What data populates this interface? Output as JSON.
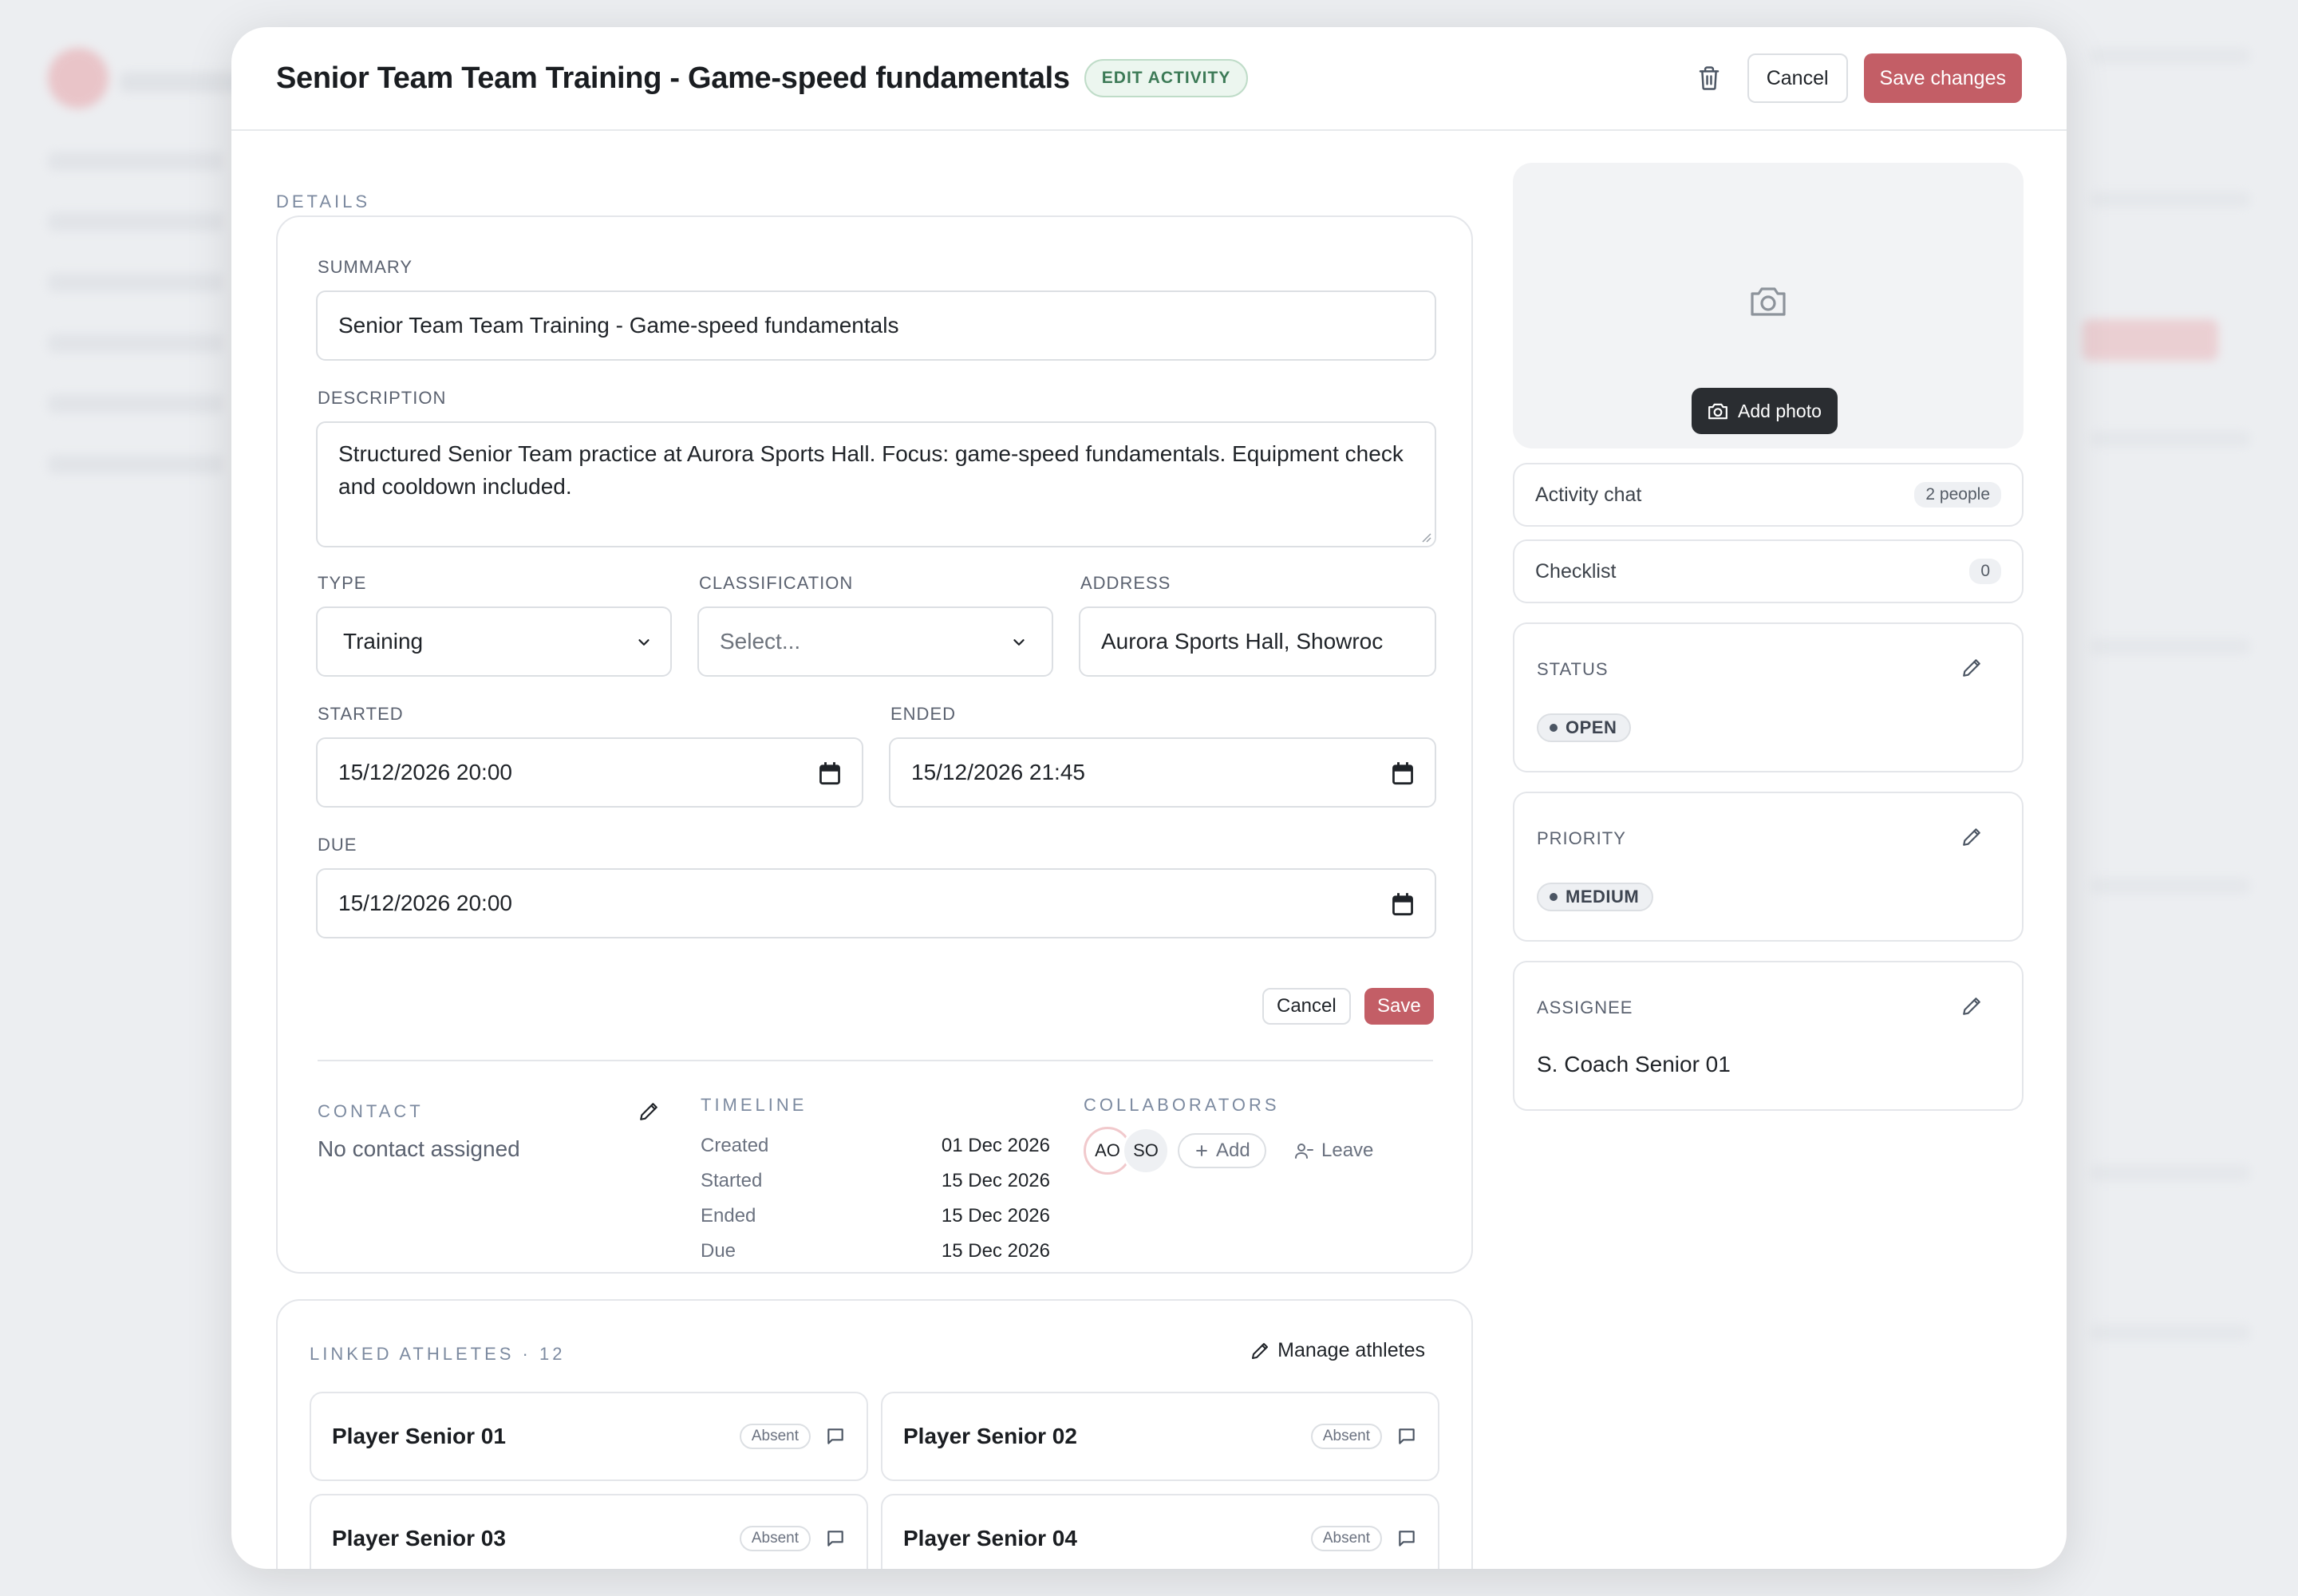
{
  "modal": {
    "title": "Senior Team Team Training - Game-speed fundamentals",
    "badge": "EDIT ACTIVITY",
    "cancel_label": "Cancel",
    "save_label": "Save changes"
  },
  "details": {
    "section_label": "DETAILS",
    "summary": {
      "label": "SUMMARY",
      "value": "Senior Team Team Training - Game-speed fundamentals"
    },
    "description": {
      "label": "DESCRIPTION",
      "value": "Structured Senior Team practice at Aurora Sports Hall. Focus: game-speed fundamentals. Equipment check and cooldown included."
    },
    "type": {
      "label": "TYPE",
      "value": "Training"
    },
    "classification": {
      "label": "CLASSIFICATION",
      "placeholder": "Select..."
    },
    "address": {
      "label": "ADDRESS",
      "value": "Aurora Sports Hall, Showroc"
    },
    "started": {
      "label": "STARTED",
      "value": "15/12/2026 20:00"
    },
    "ended": {
      "label": "ENDED",
      "value": "15/12/2026 21:45"
    },
    "due": {
      "label": "DUE",
      "value": "15/12/2026 20:00"
    },
    "form_cancel": "Cancel",
    "form_save": "Save"
  },
  "contact": {
    "label": "CONTACT",
    "value": "No contact assigned"
  },
  "timeline": {
    "label": "TIMELINE",
    "rows": [
      {
        "label": "Created",
        "value": "01 Dec 2026"
      },
      {
        "label": "Started",
        "value": "15 Dec 2026"
      },
      {
        "label": "Ended",
        "value": "15 Dec 2026"
      },
      {
        "label": "Due",
        "value": "15 Dec 2026"
      }
    ]
  },
  "collaborators": {
    "label": "COLLABORATORS",
    "avatars": [
      "AO",
      "SO"
    ],
    "add_label": "Add",
    "leave_label": "Leave"
  },
  "athletes": {
    "label": "LINKED ATHLETES · 12",
    "manage_label": "Manage athletes",
    "items": [
      {
        "name": "Player Senior 01",
        "status": "Absent"
      },
      {
        "name": "Player Senior 02",
        "status": "Absent"
      },
      {
        "name": "Player Senior 03",
        "status": "Absent"
      },
      {
        "name": "Player Senior 04",
        "status": "Absent"
      }
    ]
  },
  "sidebar": {
    "add_photo_label": "Add photo",
    "activity_chat": {
      "label": "Activity chat",
      "count": "2 people"
    },
    "checklist": {
      "label": "Checklist",
      "count": "0"
    },
    "status": {
      "label": "STATUS",
      "value": "OPEN"
    },
    "priority": {
      "label": "PRIORITY",
      "value": "MEDIUM"
    },
    "assignee": {
      "label": "ASSIGNEE",
      "value": "S. Coach Senior 01"
    }
  },
  "colors": {
    "accent": "#c35e66",
    "badge_green": "#3c7a56",
    "dark_button": "#2a2d31"
  },
  "icons": [
    "trash-icon",
    "chevron-down-icon",
    "calendar-icon",
    "pencil-icon",
    "plus-icon",
    "user-minus-icon",
    "message-square-icon",
    "camera-icon"
  ]
}
